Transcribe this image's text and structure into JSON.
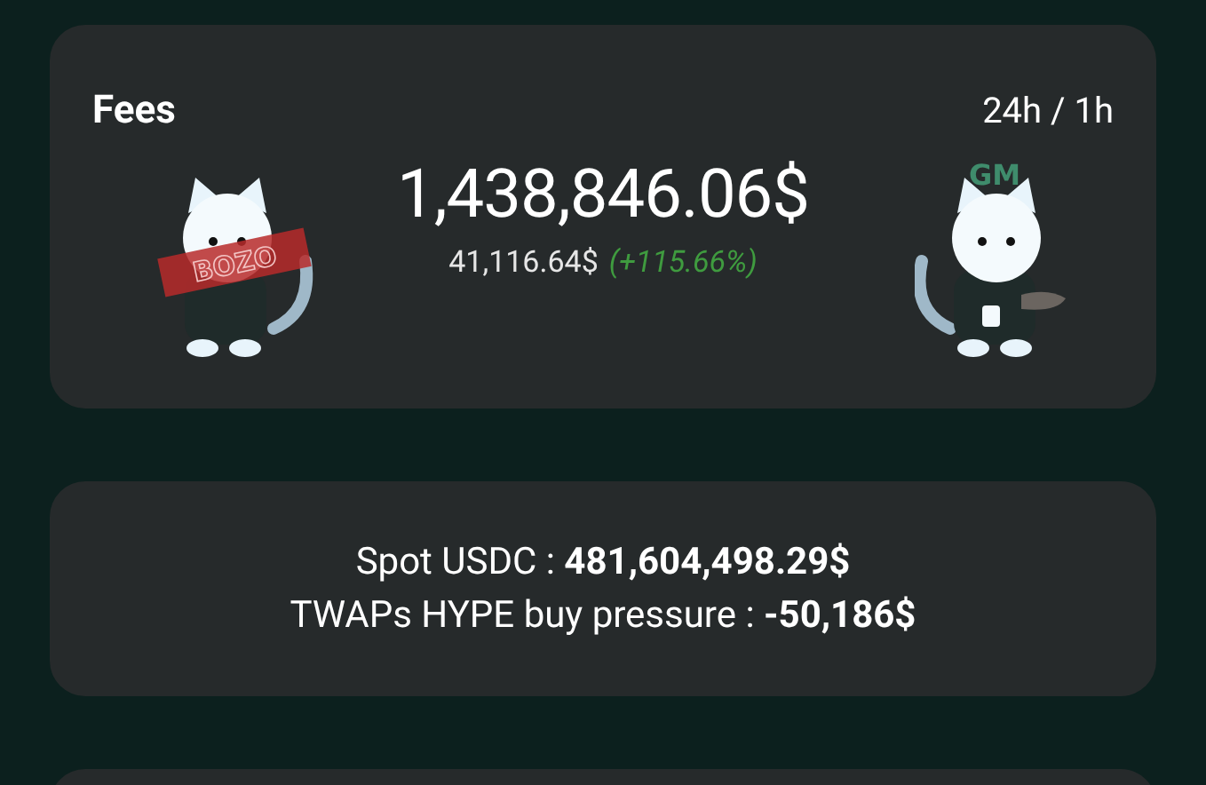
{
  "fees_card": {
    "title": "Fees",
    "period": "24h / 1h",
    "total": "1,438,846.06$",
    "hourly": "41,116.64$",
    "change": "(+115.66%)",
    "left_stamp": "BOZO",
    "right_caption": "GM"
  },
  "stats_card": {
    "lines": [
      {
        "label": "Spot USDC : ",
        "value": "481,604,498.29$"
      },
      {
        "label": "TWAPs HYPE buy pressure : ",
        "value": "-50,186$"
      }
    ]
  }
}
